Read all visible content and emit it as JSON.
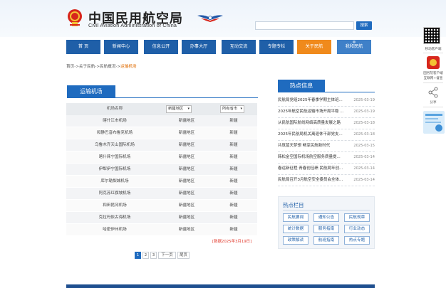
{
  "header": {
    "title_cn": "中国民用航空局",
    "title_en": "Civil Aviation Administration of China",
    "search_placeholder": "",
    "search_button": "搜索"
  },
  "nav": {
    "items": [
      {
        "label": "首 页",
        "state": "normal"
      },
      {
        "label": "新闻中心",
        "state": "normal"
      },
      {
        "label": "信息公开",
        "state": "normal"
      },
      {
        "label": "办事大厅",
        "state": "normal"
      },
      {
        "label": "互动交流",
        "state": "normal"
      },
      {
        "label": "专题专栏",
        "state": "normal"
      },
      {
        "label": "关于民航",
        "state": "active"
      },
      {
        "label": "我和民航",
        "state": "light"
      }
    ]
  },
  "breadcrumb": {
    "items": [
      "首页",
      "关于民航",
      "民航概况"
    ],
    "separator": "->",
    "current": "运输机场"
  },
  "airports": {
    "section_title": "运输机场",
    "header": {
      "name_col": "机场名称",
      "region_filter": "新疆地区",
      "city_filter": "所有省市"
    },
    "rows": [
      {
        "name": "喀什江市机场",
        "region": "新疆地区",
        "province": "新疆"
      },
      {
        "name": "和静巴音布鲁克机场",
        "region": "新疆地区",
        "province": "新疆"
      },
      {
        "name": "乌鲁木齐天山国际机场",
        "region": "新疆地区",
        "province": "新疆"
      },
      {
        "name": "喀什徕宁国际机场",
        "region": "新疆地区",
        "province": "新疆"
      },
      {
        "name": "伊犁伊宁国际机场",
        "region": "新疆地区",
        "province": "新疆"
      },
      {
        "name": "库尔勒梨城机场",
        "region": "新疆地区",
        "province": "新疆"
      },
      {
        "name": "阿克苏红旗坡机场",
        "region": "新疆地区",
        "province": "新疆"
      },
      {
        "name": "和田昆冈机场",
        "region": "新疆地区",
        "province": "新疆"
      },
      {
        "name": "克拉玛依古海机场",
        "region": "新疆地区",
        "province": "新疆"
      },
      {
        "name": "哈密伊州机场",
        "region": "新疆地区",
        "province": "新疆"
      }
    ],
    "note": "[数据2025年3月19日]",
    "pager": [
      "1",
      "2",
      "3",
      "下一页",
      "尾页"
    ]
  },
  "hot_news": {
    "title": "热点信息",
    "items": [
      {
        "title": "民航局党组2025年春季学期主体班...",
        "date": "2025-03-19"
      },
      {
        "title": "2025年航空民航运输市场开局平稳 ...",
        "date": "2025-03-19"
      },
      {
        "title": "从民航国际航线网络高质量发展之路",
        "date": "2025-03-18"
      },
      {
        "title": "2025年民航局机关离退休干部党支...",
        "date": "2025-03-18"
      },
      {
        "title": "共筑蓝天梦想 畅享民航新时代",
        "date": "2025-03-15"
      },
      {
        "title": "韩松金空国际机场航空服务质量提...",
        "date": "2025-03-14"
      },
      {
        "title": "春运新征程 青春创佳绩 民航局年创...",
        "date": "2025-03-14"
      },
      {
        "title": "民航局召开3月航空安全委员会全体...",
        "date": "2025-03-14"
      }
    ]
  },
  "hot_categories": {
    "title": "热点栏目",
    "items": [
      "民航要闻",
      "通知公告",
      "民航规章",
      "统计数据",
      "服务指南",
      "行业动态",
      "政策解读",
      "航班指南",
      "热点专题"
    ]
  },
  "side_tools": {
    "wechat_label": "移动客户端",
    "app_label": "国务院客户端",
    "app_label2": "互联网+督查",
    "share_label": "分享"
  },
  "colors": {
    "nav_blue": "#1f5fa8",
    "accent_orange": "#f08a1c",
    "link_blue": "#1f6bbf",
    "note_red": "#e23b2e"
  }
}
